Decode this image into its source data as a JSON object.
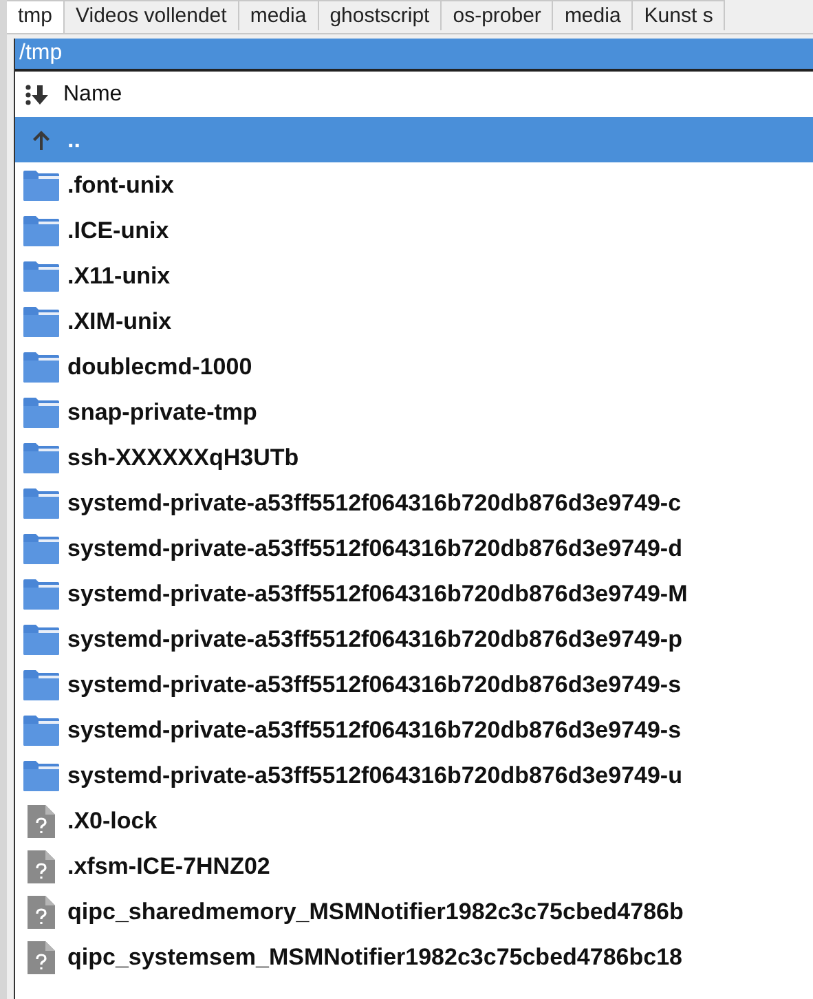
{
  "tabs": [
    {
      "label": "tmp",
      "selected": true
    },
    {
      "label": "Videos vollendet",
      "selected": false
    },
    {
      "label": "media",
      "selected": false
    },
    {
      "label": "ghostscript",
      "selected": false
    },
    {
      "label": "os-prober",
      "selected": false
    },
    {
      "label": "media",
      "selected": false
    },
    {
      "label": "Kunst s",
      "selected": false
    }
  ],
  "path": "/tmp",
  "column_header": "Name",
  "rows": [
    {
      "name": "..",
      "kind": "parent",
      "selected": true
    },
    {
      "name": ".font-unix",
      "kind": "folder",
      "selected": false
    },
    {
      "name": ".ICE-unix",
      "kind": "folder",
      "selected": false
    },
    {
      "name": ".X11-unix",
      "kind": "folder",
      "selected": false
    },
    {
      "name": ".XIM-unix",
      "kind": "folder",
      "selected": false
    },
    {
      "name": "doublecmd-1000",
      "kind": "folder",
      "selected": false
    },
    {
      "name": "snap-private-tmp",
      "kind": "folder",
      "selected": false
    },
    {
      "name": "ssh-XXXXXXqH3UTb",
      "kind": "folder",
      "selected": false
    },
    {
      "name": "systemd-private-a53ff5512f064316b720db876d3e9749-c",
      "kind": "folder",
      "selected": false
    },
    {
      "name": "systemd-private-a53ff5512f064316b720db876d3e9749-d",
      "kind": "folder",
      "selected": false
    },
    {
      "name": "systemd-private-a53ff5512f064316b720db876d3e9749-M",
      "kind": "folder",
      "selected": false
    },
    {
      "name": "systemd-private-a53ff5512f064316b720db876d3e9749-p",
      "kind": "folder",
      "selected": false
    },
    {
      "name": "systemd-private-a53ff5512f064316b720db876d3e9749-s",
      "kind": "folder",
      "selected": false
    },
    {
      "name": "systemd-private-a53ff5512f064316b720db876d3e9749-s",
      "kind": "folder",
      "selected": false
    },
    {
      "name": "systemd-private-a53ff5512f064316b720db876d3e9749-u",
      "kind": "folder",
      "selected": false
    },
    {
      "name": ".X0-lock",
      "kind": "file",
      "selected": false
    },
    {
      "name": ".xfsm-ICE-7HNZ02",
      "kind": "file",
      "selected": false
    },
    {
      "name": "qipc_sharedmemory_MSMNotifier1982c3c75cbed4786b",
      "kind": "file",
      "selected": false
    },
    {
      "name": "qipc_systemsem_MSMNotifier1982c3c75cbed4786bc18",
      "kind": "file",
      "selected": false
    }
  ]
}
